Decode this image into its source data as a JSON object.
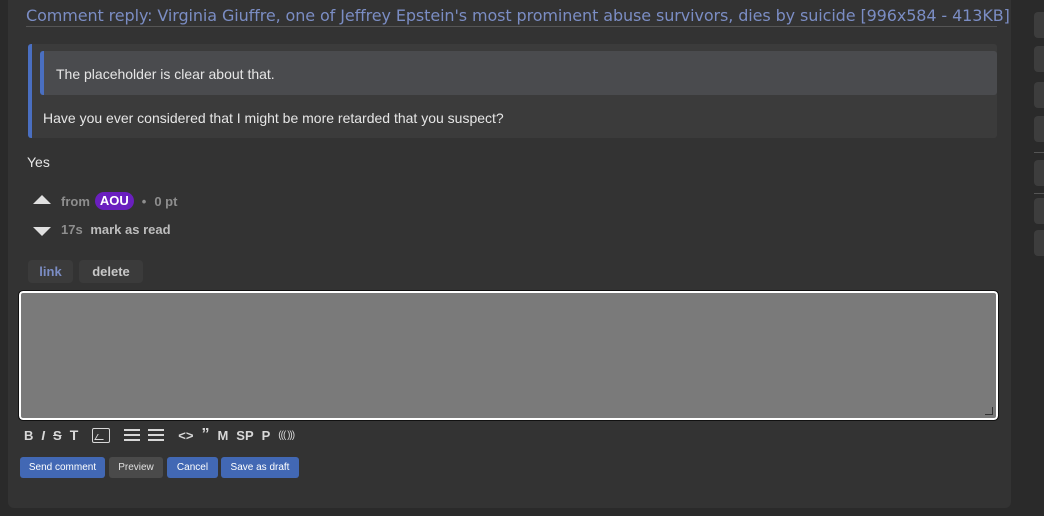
{
  "post": {
    "title": "Comment reply: Virginia Giuffre, one of Jeffrey Epstein's most prominent abuse survivors, dies by suicide [996x584 - 413KB]"
  },
  "comment": {
    "quote_inner": "The placeholder is clear about that.",
    "quote_outer": "Have you ever considered that I might be more retarded that you suspect?",
    "body": "Yes",
    "from_label": "from",
    "author": "AOU",
    "score": "0 pt",
    "age": "17s",
    "mark_read": "mark as read",
    "link_label": "link",
    "delete_label": "delete"
  },
  "reply_form": {
    "textarea_value": "",
    "toolbar": {
      "bold": "B",
      "italic": "I",
      "strike": "S",
      "heading": "T",
      "code": "<>",
      "quote": "”",
      "math": "M",
      "spoiler": "SP",
      "paragraph": "P",
      "sound": "((( )))"
    },
    "send_label": "Send comment",
    "preview_label": "Preview",
    "cancel_label": "Cancel",
    "draft_label": "Save as draft"
  },
  "colors": {
    "background": "#333333",
    "link": "#7b8dc4",
    "accent_blue": "#4268b4",
    "user_badge": "#6a1fbf",
    "quote_border": "#4a6fc1"
  },
  "icons": [
    "upvote-icon",
    "downvote-icon",
    "image-icon",
    "unordered-list-icon",
    "ordered-list-icon"
  ]
}
